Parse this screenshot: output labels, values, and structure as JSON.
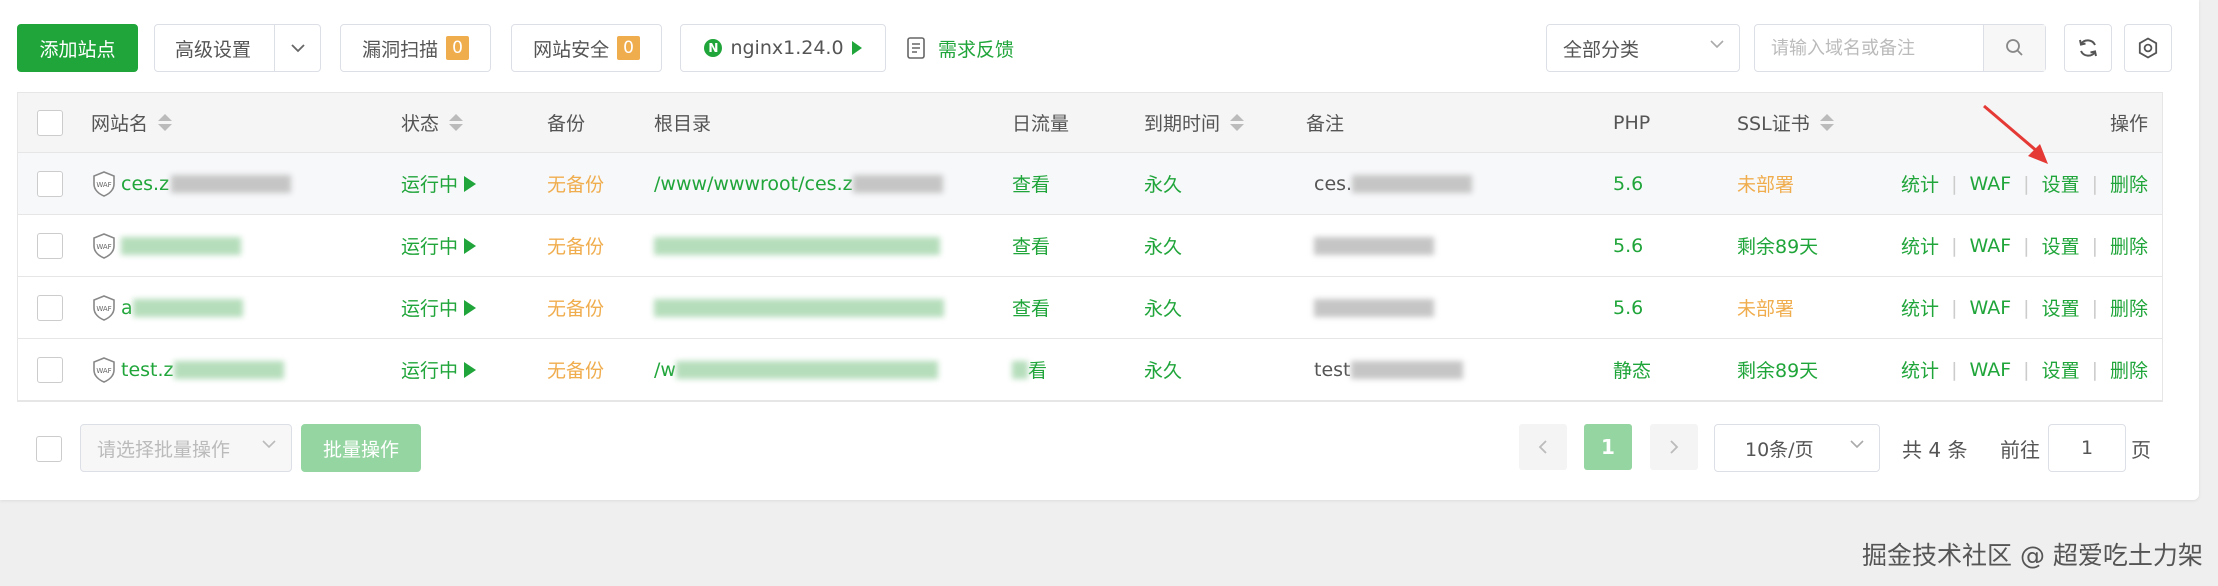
{
  "toolbar": {
    "add_site": "添加站点",
    "advanced": "高级设置",
    "vuln_scan": "漏洞扫描",
    "vuln_count": "0",
    "site_security": "网站安全",
    "security_count": "0",
    "nginx": "nginx1.24.0",
    "nginx_letter": "N",
    "feedback": "需求反馈",
    "category": "全部分类",
    "search_placeholder": "请输入域名或备注"
  },
  "columns": {
    "site_name": "网站名",
    "status": "状态",
    "backup": "备份",
    "root": "根目录",
    "traffic": "日流量",
    "expire": "到期时间",
    "remark": "备注",
    "php": "PHP",
    "ssl": "SSL证书",
    "ops": "操作"
  },
  "rows": [
    {
      "name": "ces.z",
      "status": "运行中",
      "backup": "无备份",
      "root": "/www/wwwroot/ces.z",
      "traffic": "查看",
      "expire": "永久",
      "remark": "ces.",
      "php": "5.6",
      "ssl": "未部署"
    },
    {
      "name": "",
      "status": "运行中",
      "backup": "无备份",
      "root": "",
      "traffic": "查看",
      "expire": "永久",
      "remark": "",
      "php": "5.6",
      "ssl": "剩余89天"
    },
    {
      "name": "a",
      "status": "运行中",
      "backup": "无备份",
      "root": "",
      "traffic": "查看",
      "expire": "永久",
      "remark": "",
      "php": "5.6",
      "ssl": "未部署"
    },
    {
      "name": "test.z",
      "status": "运行中",
      "backup": "无备份",
      "root": "/w",
      "traffic": "看",
      "expire": "永久",
      "remark": "test",
      "php": "静态",
      "ssl": "剩余89天"
    }
  ],
  "row_ops": {
    "stats": "统计",
    "waf": "WAF",
    "settings": "设置",
    "delete": "删除"
  },
  "shield_label": "WAF",
  "footer": {
    "batch_placeholder": "请选择批量操作",
    "batch_button": "批量操作",
    "current_page": "1",
    "page_size": "10条/页",
    "total": "共 4 条",
    "goto_label": "前往",
    "goto_value": "1",
    "page_suffix": "页"
  },
  "watermark": "掘金技术社区 @ 超爱吃土力架",
  "colors": {
    "accent": "#20a53a",
    "warning": "#f0ad4e",
    "annotation_arrow": "#e53935"
  }
}
